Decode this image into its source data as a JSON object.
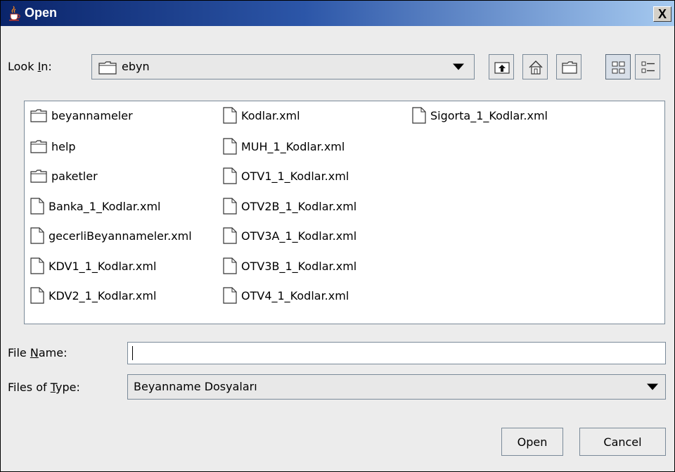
{
  "window": {
    "title": "Open",
    "close_glyph": "X"
  },
  "look_in": {
    "label_prefix": "Look ",
    "label_mnemonic": "I",
    "label_suffix": "n:",
    "value": "ebyn"
  },
  "toolbar": [
    {
      "name": "up-one-level-icon"
    },
    {
      "name": "home-icon"
    },
    {
      "name": "new-folder-icon"
    },
    {
      "name": "list-view-icon"
    },
    {
      "name": "details-view-icon"
    }
  ],
  "files": {
    "column1": [
      {
        "type": "folder",
        "label": "beyannameler"
      },
      {
        "type": "folder",
        "label": "help"
      },
      {
        "type": "folder",
        "label": "paketler"
      },
      {
        "type": "file",
        "label": "Banka_1_Kodlar.xml"
      },
      {
        "type": "file",
        "label": "gecerliBeyannameler.xml"
      },
      {
        "type": "file",
        "label": "KDV1_1_Kodlar.xml"
      },
      {
        "type": "file",
        "label": "KDV2_1_Kodlar.xml"
      }
    ],
    "column2": [
      {
        "type": "file",
        "label": "Kodlar.xml"
      },
      {
        "type": "file",
        "label": "MUH_1_Kodlar.xml"
      },
      {
        "type": "file",
        "label": "OTV1_1_Kodlar.xml"
      },
      {
        "type": "file",
        "label": "OTV2B_1_Kodlar.xml"
      },
      {
        "type": "file",
        "label": "OTV3A_1_Kodlar.xml"
      },
      {
        "type": "file",
        "label": "OTV3B_1_Kodlar.xml"
      },
      {
        "type": "file",
        "label": "OTV4_1_Kodlar.xml"
      }
    ],
    "column3": [
      {
        "type": "file",
        "label": "Sigorta_1_Kodlar.xml"
      }
    ]
  },
  "file_name": {
    "label_prefix": "File ",
    "label_mnemonic": "N",
    "label_suffix": "ame:",
    "value": "",
    "placeholder": ""
  },
  "files_of_type": {
    "label_prefix": "Files of ",
    "label_mnemonic": "T",
    "label_suffix": "ype:",
    "value": "Beyanname Dosyaları"
  },
  "buttons": {
    "open": "Open",
    "cancel": "Cancel"
  }
}
